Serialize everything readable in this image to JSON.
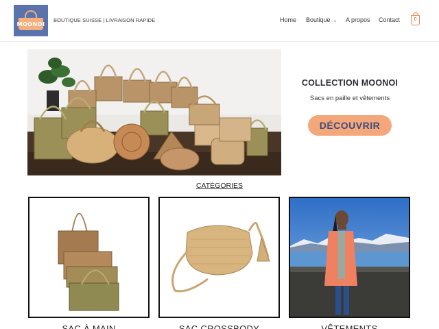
{
  "brand": {
    "logo_text": "MOONOI",
    "tagline": "BOUTIQUE SUISSE | LIVRAISON RAPIDE",
    "accent_color": "#f4a77a",
    "logo_bg_color": "#5a73ad"
  },
  "nav": {
    "items": [
      {
        "label": "Home"
      },
      {
        "label": "Boutique"
      },
      {
        "label": "A propos"
      },
      {
        "label": "Contact"
      }
    ],
    "cart_count": "0"
  },
  "hero": {
    "title": "COLLECTION MOONOI",
    "subtitle": "Sacs en paille et vêtements",
    "cta_label": "DÉCOUVRIR"
  },
  "categories": {
    "title": "CATÉGORIES",
    "items": [
      {
        "label": "SAC À MAIN"
      },
      {
        "label": "SAC CROSSBODY"
      },
      {
        "label": "VÊTEMENTS"
      }
    ]
  }
}
